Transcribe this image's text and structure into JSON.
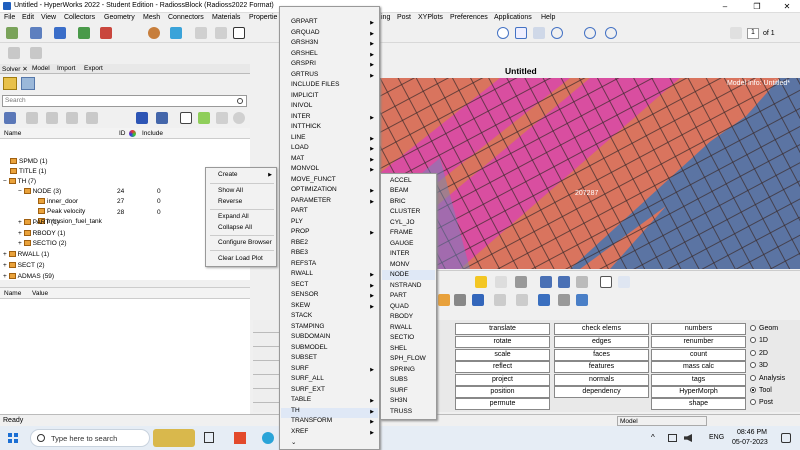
{
  "window": {
    "title": "Untitled - HyperWorks 2022 - Student Edition - RadiossBlock (Radioss2022 Format)",
    "minimize": "–",
    "maximize": "❐",
    "close": "✕"
  },
  "menubar": [
    "File",
    "Edit",
    "View",
    "Collectors",
    "Geometry",
    "Mesh",
    "Connectors",
    "Materials",
    "Propertie",
    "ing",
    "Post",
    "XYPlots",
    "Preferences",
    "Applications",
    "Help"
  ],
  "pager": {
    "value": "1",
    "label": "of 1"
  },
  "left_tabs": [
    "Solver ✕",
    "Model",
    "Import",
    "Export"
  ],
  "search": {
    "placeholder": "Search"
  },
  "tree_header": {
    "name": "Name",
    "id": "ID",
    "include": "Include"
  },
  "tree": [
    {
      "label": "SPMD (1)"
    },
    {
      "label": "TITLE (1)"
    },
    {
      "label": "TH (7)"
    },
    {
      "label": "NODE (3)"
    },
    {
      "label": "inner_door",
      "id": "24",
      "include": "0"
    },
    {
      "label": "Peak velocity",
      "id": "27",
      "include": "0"
    },
    {
      "label": "Intrusion_fuel_tank",
      "id": "28",
      "include": "0"
    },
    {
      "label": "PART (1)"
    },
    {
      "label": "RBODY (1)"
    },
    {
      "label": "SECTIO (2)"
    },
    {
      "label": "RWALL (1)"
    },
    {
      "label": "SECT (2)"
    },
    {
      "label": "ADMAS (59)"
    }
  ],
  "props_header": {
    "name": "Name",
    "value": "Value"
  },
  "context_menu": [
    "Create",
    "Show All",
    "Reverse",
    "Expand All",
    "Collapse All",
    "Configure Browser",
    "Clear Load Plot"
  ],
  "menu1": [
    "GRPART",
    "GRQUAD",
    "GRSH3N",
    "GRSHEL",
    "GRSPRI",
    "GRTRUS",
    "INCLUDE FILES",
    "IMPLICIT",
    "INIVOL",
    "INTER",
    "INTTHICK",
    "LINE",
    "LOAD",
    "MAT",
    "MONVOL",
    "MOVE_FUNCT",
    "OPTIMIZATION",
    "PARAMETER",
    "PART",
    "PLY",
    "PROP",
    "RBE2",
    "RBE3",
    "REFSTA",
    "RWALL",
    "SECT",
    "SENSOR",
    "SKEW",
    "STACK",
    "STAMPING",
    "SUBDOMAIN",
    "SUBMODEL",
    "SUBSET",
    "SURF",
    "SURF_ALL",
    "SURF_EXT",
    "TABLE",
    "TH",
    "TRANSFORM",
    "XREF"
  ],
  "menu1_submenu_items": [
    "GRPART",
    "GRQUAD",
    "GRSH3N",
    "GRSHEL",
    "GRSPRI",
    "GRTRUS",
    "INTER",
    "LINE",
    "LOAD",
    "MAT",
    "MONVOL",
    "OPTIMIZATION",
    "PARAMETER",
    "PROP",
    "RWALL",
    "SECT",
    "SENSOR",
    "SKEW",
    "SURF",
    "TABLE",
    "TH",
    "TRANSFORM",
    "XREF"
  ],
  "menu1_scroll": "⌄",
  "menu2": [
    "ACCEL",
    "BEAM",
    "BRIC",
    "CLUSTER",
    "CYL_JO",
    "FRAME",
    "GAUGE",
    "INTER",
    "MONV",
    "NODE",
    "NSTRAND",
    "PART",
    "QUAD",
    "RBODY",
    "RWALL",
    "SECTIO",
    "SHEL",
    "SPH_FLOW",
    "SPRING",
    "SUBS",
    "SURF",
    "SH3N",
    "TRUSS"
  ],
  "viewport": {
    "title": "Untitled",
    "model_info": "Model Info: Untitled*",
    "node_label": "207287"
  },
  "panel_buttons": [
    [
      "translate",
      "check elems",
      "numbers"
    ],
    [
      "rotate",
      "edges",
      "renumber"
    ],
    [
      "scale",
      "faces",
      "count"
    ],
    [
      "reflect",
      "features",
      "mass calc"
    ],
    [
      "project",
      "normals",
      "tags"
    ],
    [
      "position",
      "dependency",
      "HyperMorph"
    ],
    [
      "permute",
      "",
      "shape"
    ]
  ],
  "radio": [
    {
      "label": "Geom",
      "checked": false
    },
    {
      "label": "1D",
      "checked": false
    },
    {
      "label": "2D",
      "checked": false
    },
    {
      "label": "3D",
      "checked": false
    },
    {
      "label": "Analysis",
      "checked": false
    },
    {
      "label": "Tool",
      "checked": true
    },
    {
      "label": "Post",
      "checked": false
    }
  ],
  "status": {
    "left": "Ready",
    "model": "Model"
  },
  "taskbar": {
    "search": "Type here to search",
    "lang": "ENG",
    "time": "08:46 PM",
    "date": "05-07-2023"
  },
  "colors": {
    "viewport_bg": "#5b74a3",
    "mesh_salmon": "#d9745e",
    "mesh_magenta": "#d94ea0",
    "menu_bg": "#f2f2f2",
    "highlight": "#dfe8f6"
  }
}
